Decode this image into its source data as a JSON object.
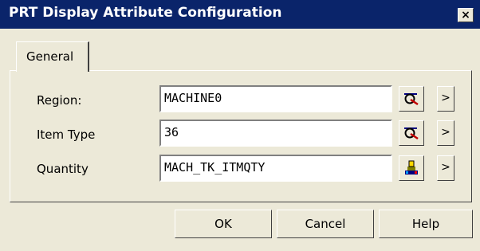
{
  "window": {
    "title": "PRT Display Attribute Configuration",
    "close_symbol": "×"
  },
  "tabs": [
    {
      "label": "General",
      "active": true
    }
  ],
  "form": {
    "rows": [
      {
        "label": "Region:",
        "value": "MACHINE0",
        "icon": "machine-select-icon"
      },
      {
        "label": "Item Type",
        "value": "36",
        "icon": "machine-select-icon"
      },
      {
        "label": "Quantity",
        "value": "MACH_TK_ITMQTY",
        "icon": "tag-browse-icon"
      }
    ],
    "arrow_symbol": ">"
  },
  "buttons": {
    "ok": "OK",
    "cancel": "Cancel",
    "help": "Help"
  }
}
